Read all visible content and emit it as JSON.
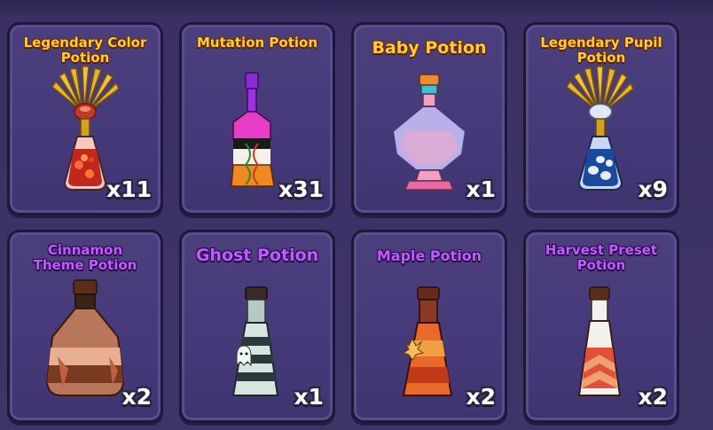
{
  "items": [
    {
      "name": "Legendary Color Potion",
      "line1": "Legendary Color",
      "line2": "Potion",
      "qty": "x11",
      "theme": "gold"
    },
    {
      "name": "Mutation Potion",
      "line1": "Mutation Potion",
      "line2": "",
      "qty": "x31",
      "theme": "gold"
    },
    {
      "name": "Baby Potion",
      "line1": "Baby Potion",
      "line2": "",
      "qty": "x1",
      "theme": "gold"
    },
    {
      "name": "Legendary Pupil Potion",
      "line1": "Legendary Pupil",
      "line2": "Potion",
      "qty": "x9",
      "theme": "gold"
    },
    {
      "name": "Cinnamon Theme Potion",
      "line1": "Cinnamon",
      "line2": "Theme Potion",
      "qty": "x2",
      "theme": "purple"
    },
    {
      "name": "Ghost Potion",
      "line1": "Ghost Potion",
      "line2": "",
      "qty": "x1",
      "theme": "purple"
    },
    {
      "name": "Maple Potion",
      "line1": "Maple Potion",
      "line2": "",
      "qty": "x2",
      "theme": "purple"
    },
    {
      "name": "Harvest Preset Potion",
      "line1": "Harvest Preset",
      "line2": "Potion",
      "qty": "x2",
      "theme": "purple"
    }
  ],
  "icons": [
    "legendary-color-potion-icon",
    "mutation-potion-icon",
    "baby-potion-icon",
    "legendary-pupil-potion-icon",
    "cinnamon-theme-potion-icon",
    "ghost-potion-icon",
    "maple-potion-icon",
    "harvest-preset-potion-icon"
  ]
}
